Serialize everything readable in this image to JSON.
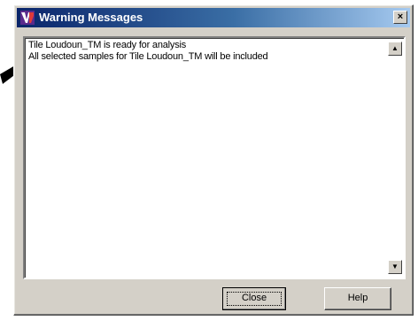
{
  "window": {
    "title": "Warning Messages",
    "close_glyph": "×",
    "icon": "app-logo-icon"
  },
  "messages": [
    "Tile Loudoun_TM is ready for analysis",
    "All selected samples for Tile Loudoun_TM will be included"
  ],
  "scrollbar": {
    "up_glyph": "▲",
    "down_glyph": "▼"
  },
  "buttons": {
    "close_label": "Close",
    "help_label": "Help"
  },
  "colors": {
    "dialog_face": "#d4d0c8",
    "titlebar_start": "#0a246a",
    "titlebar_end": "#a6caf0",
    "text_area": "#ffffff"
  }
}
